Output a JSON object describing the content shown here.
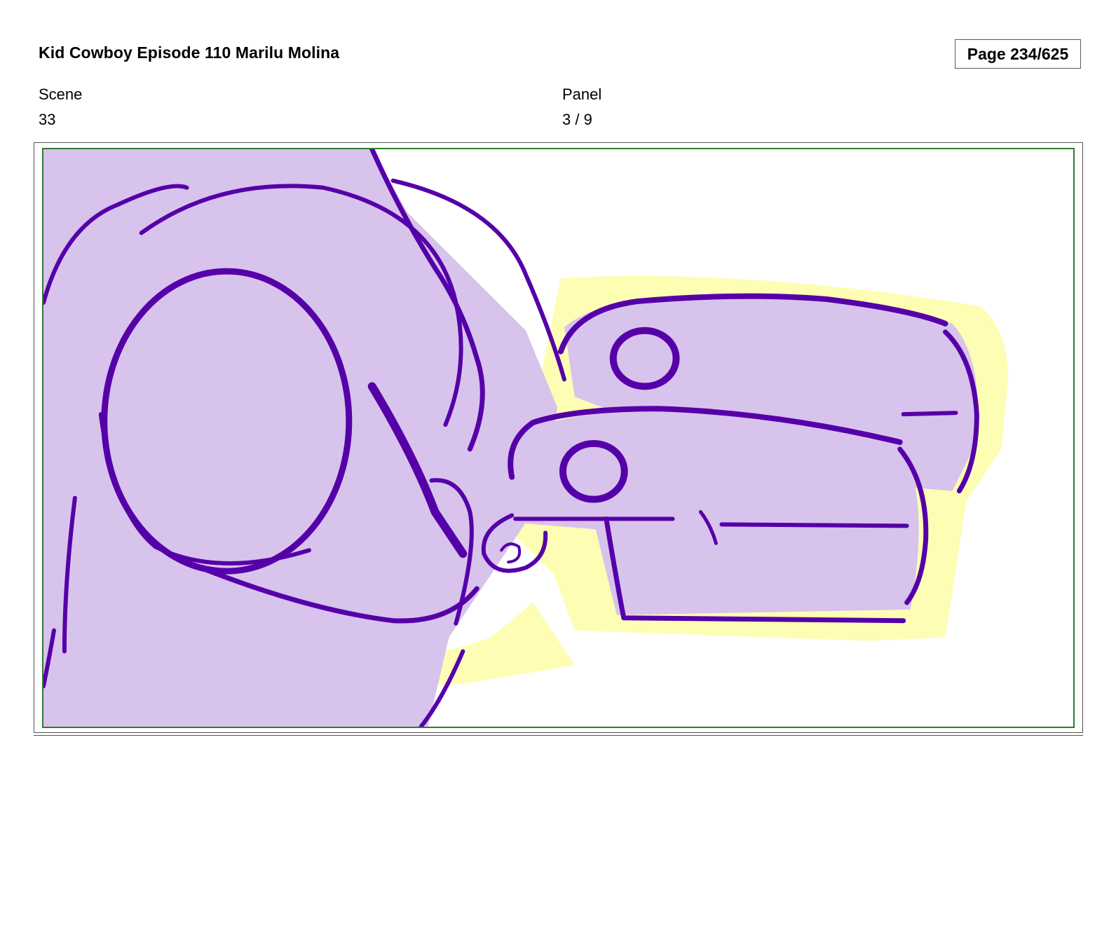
{
  "header": {
    "title": "Kid Cowboy Episode 110 Marilu Molina",
    "page": "Page 234/625"
  },
  "fields": {
    "scene_label": "Scene",
    "scene_value": "33",
    "panel_label": "Panel",
    "panel_value": "3 / 9"
  },
  "artwork": {
    "subject": "storyboard sketch of a cartoon character's hand holding a small object",
    "colors": {
      "fill": "#D8C3EC",
      "outline": "#5500A8",
      "highlight": "#FDFDB4",
      "panel_border": "#2E7D32"
    }
  }
}
